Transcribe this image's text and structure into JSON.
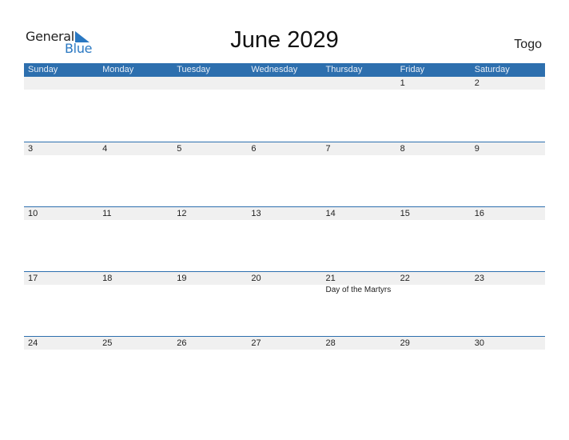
{
  "logo": {
    "word1": "General",
    "word2": "Blue",
    "icon": "triangle-logo-icon",
    "color": "#2a78c2"
  },
  "title": "June 2029",
  "country": "Togo",
  "colors": {
    "header_bg": "#2d6fae",
    "date_strip_bg": "#f0f0f0"
  },
  "weekdays": [
    "Sunday",
    "Monday",
    "Tuesday",
    "Wednesday",
    "Thursday",
    "Friday",
    "Saturday"
  ],
  "weeks": [
    {
      "days": [
        "",
        "",
        "",
        "",
        "",
        "1",
        "2"
      ],
      "events": [
        "",
        "",
        "",
        "",
        "",
        "",
        ""
      ]
    },
    {
      "days": [
        "3",
        "4",
        "5",
        "6",
        "7",
        "8",
        "9"
      ],
      "events": [
        "",
        "",
        "",
        "",
        "",
        "",
        ""
      ]
    },
    {
      "days": [
        "10",
        "11",
        "12",
        "13",
        "14",
        "15",
        "16"
      ],
      "events": [
        "",
        "",
        "",
        "",
        "",
        "",
        ""
      ]
    },
    {
      "days": [
        "17",
        "18",
        "19",
        "20",
        "21",
        "22",
        "23"
      ],
      "events": [
        "",
        "",
        "",
        "",
        "Day of the Martyrs",
        "",
        ""
      ]
    },
    {
      "days": [
        "24",
        "25",
        "26",
        "27",
        "28",
        "29",
        "30"
      ],
      "events": [
        "",
        "",
        "",
        "",
        "",
        "",
        ""
      ]
    }
  ]
}
